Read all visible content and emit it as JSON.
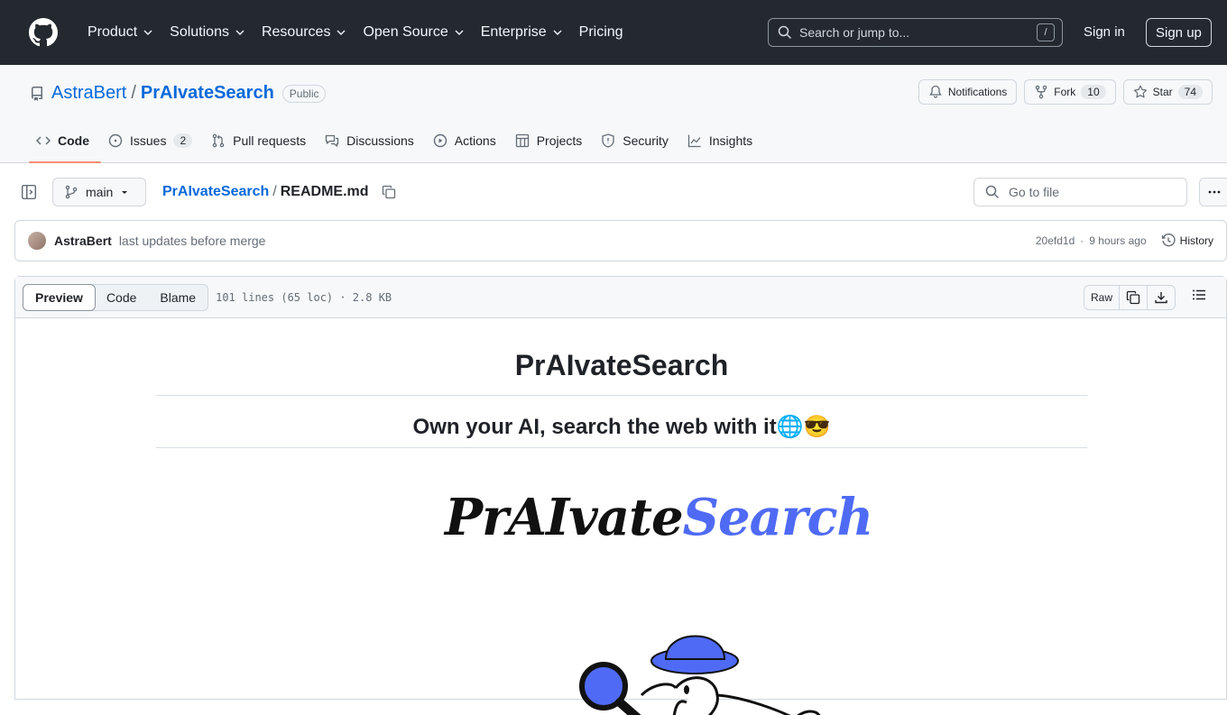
{
  "topnav": {
    "items": [
      {
        "label": "Product",
        "dropdown": true
      },
      {
        "label": "Solutions",
        "dropdown": true
      },
      {
        "label": "Resources",
        "dropdown": true
      },
      {
        "label": "Open Source",
        "dropdown": true
      },
      {
        "label": "Enterprise",
        "dropdown": true
      },
      {
        "label": "Pricing",
        "dropdown": false
      }
    ],
    "search_placeholder": "Search or jump to...",
    "search_key": "/",
    "signin": "Sign in",
    "signup": "Sign up"
  },
  "repo": {
    "owner": "AstraBert",
    "separator": "/",
    "name": "PrAIvateSearch",
    "visibility": "Public",
    "notifications_label": "Notifications",
    "fork_label": "Fork",
    "fork_count": "10",
    "star_label": "Star",
    "star_count": "74"
  },
  "tabs": [
    {
      "label": "Code",
      "icon": "code-icon",
      "active": true
    },
    {
      "label": "Issues",
      "icon": "issue-icon",
      "count": "2"
    },
    {
      "label": "Pull requests",
      "icon": "pull-request-icon"
    },
    {
      "label": "Discussions",
      "icon": "discussions-icon"
    },
    {
      "label": "Actions",
      "icon": "play-icon"
    },
    {
      "label": "Projects",
      "icon": "table-icon"
    },
    {
      "label": "Security",
      "icon": "shield-icon"
    },
    {
      "label": "Insights",
      "icon": "graph-icon"
    }
  ],
  "file": {
    "branch": "main",
    "repo_crumb": "PrAIvateSearch",
    "separator": "/",
    "filename": "README.md",
    "goto_placeholder": "Go to file"
  },
  "commit": {
    "author": "AstraBert",
    "message": "last updates before merge",
    "sha": "20efd1d",
    "dot": "·",
    "time": "9 hours ago",
    "history": "History"
  },
  "viewer": {
    "modes": [
      "Preview",
      "Code",
      "Blame"
    ],
    "active_mode": "Preview",
    "info": "101 lines (65 loc) · 2.8 KB",
    "raw": "Raw"
  },
  "readme": {
    "h1": "PrAIvateSearch",
    "h2": "Own your AI, search the web with it🌐😎",
    "logo_part1": "PrAIvate",
    "logo_part2": "Search"
  },
  "colors": {
    "header_bg": "#24292f",
    "link": "#0969da",
    "tab_underline": "#fd8c73",
    "logo_blue": "#4f6bf5"
  }
}
